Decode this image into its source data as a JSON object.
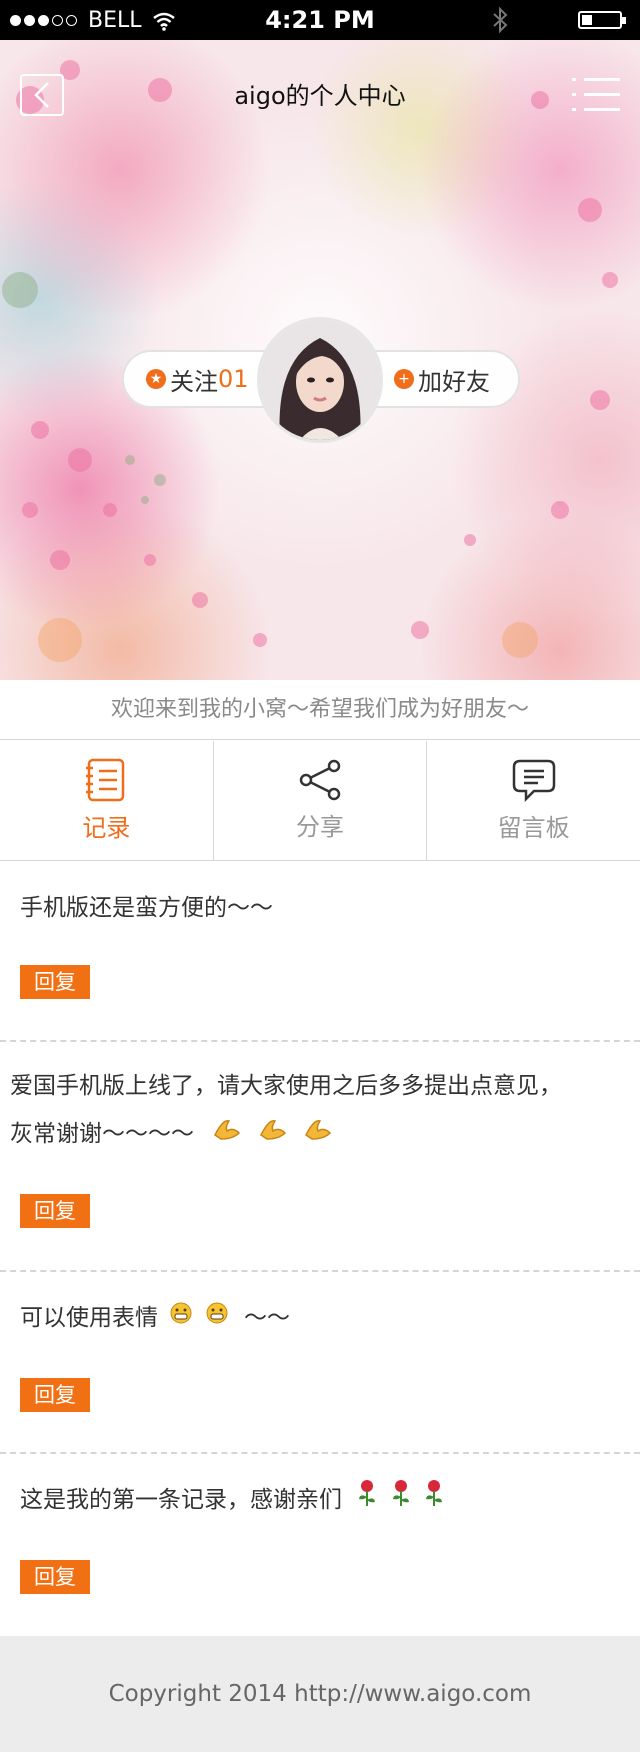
{
  "status_bar": {
    "carrier": "BELL",
    "time": "4:21 PM",
    "signal_icon": "signal-dots-icon",
    "wifi_icon": "wifi-icon",
    "bluetooth_icon": "bluetooth-icon",
    "battery_icon": "battery-icon",
    "battery_level": 0.25
  },
  "header": {
    "title": "aigo的个人中心",
    "back_icon": "back-arrow-icon",
    "menu_icon": "menu-icon"
  },
  "profile": {
    "follow_label": "关注",
    "follow_count": "01",
    "add_friend_label": "加好友",
    "follow_icon": "star-circle-icon",
    "add_friend_icon": "plus-circle-icon",
    "avatar": "user-avatar"
  },
  "welcome_text": "欢迎来到我的小窝～希望我们成为好朋友～",
  "tabs": [
    {
      "label": "记录",
      "icon": "notebook-icon",
      "active": true
    },
    {
      "label": "分享",
      "icon": "share-icon",
      "active": false
    },
    {
      "label": "留言板",
      "icon": "message-board-icon",
      "active": false
    }
  ],
  "records": [
    {
      "text": "手机版还是蛮方便的～～",
      "reply_label": "回复"
    },
    {
      "text_line1": "爱国手机版上线了，请大家使用之后多多提出点意见，",
      "text_line2": "灰常谢谢～～～～",
      "emoji": [
        "clap-hand-icon",
        "clap-hand-icon",
        "clap-hand-icon"
      ],
      "reply_label": "回复"
    },
    {
      "text": "可以使用表情",
      "text_suffix": "～～",
      "emoji": [
        "grin-face-icon",
        "grin-face-icon"
      ],
      "reply_label": "回复"
    },
    {
      "text": "这是我的第一条记录，感谢亲们",
      "emoji": [
        "rose-icon",
        "rose-icon",
        "rose-icon"
      ],
      "reply_label": "回复"
    }
  ],
  "footer": {
    "copyright": "Copyright 2014 http://www.aigo.com"
  },
  "colors": {
    "accent": "#f06d1a",
    "reply_bg": "#f27014",
    "footer_bg": "#ececec"
  }
}
